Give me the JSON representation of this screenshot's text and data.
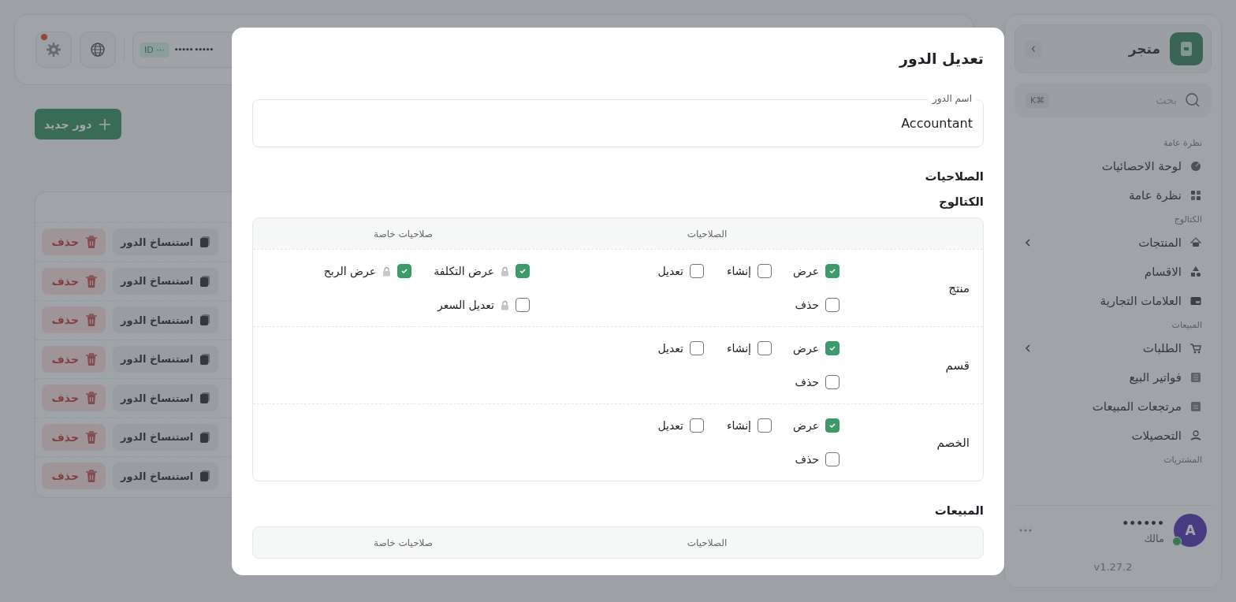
{
  "topbar": {
    "id_badge": "ID ···",
    "account": "••••• •••••",
    "settings_alert": true
  },
  "new_role_button": "دور جديد",
  "role_rows": [
    {
      "copy": "استنساخ الدور",
      "delete": "حذف"
    },
    {
      "copy": "استنساخ الدور",
      "delete": "حذف"
    },
    {
      "copy": "استنساخ الدور",
      "delete": "حذف"
    },
    {
      "copy": "استنساخ الدور",
      "delete": "حذف"
    },
    {
      "copy": "استنساخ الدور",
      "delete": "حذف"
    },
    {
      "copy": "استنساخ الدور",
      "delete": "حذف"
    },
    {
      "copy": "استنساخ الدور",
      "delete": "حذف"
    }
  ],
  "sidebar": {
    "brand": "متجر",
    "search_placeholder": "بحث",
    "shortcut": "K⌘",
    "groups": [
      {
        "label": "نظرة عامة",
        "items": [
          {
            "label": "لوحة الاحصائيات",
            "expandable": false
          },
          {
            "label": "نظرة عامة",
            "expandable": false
          }
        ]
      },
      {
        "label": "الكتالوج",
        "items": [
          {
            "label": "المنتجات",
            "expandable": true
          },
          {
            "label": "الاقسام",
            "expandable": false
          },
          {
            "label": "العلامات التجارية",
            "expandable": false
          }
        ]
      },
      {
        "label": "المبيعات",
        "items": [
          {
            "label": "الطلبات",
            "expandable": true
          },
          {
            "label": "فواتير البيع",
            "expandable": false
          },
          {
            "label": "مرتجعات المبيعات",
            "expandable": false
          },
          {
            "label": "التحصيلات",
            "expandable": false
          }
        ]
      },
      {
        "label": "المشتريات"
      }
    ],
    "user": {
      "avatar": "A",
      "name": "••••••",
      "role": "مالك",
      "online": true
    },
    "version": "v1.27.2"
  },
  "modal": {
    "title": "تعديل الدور",
    "name_field": {
      "label": "اسم الدور",
      "value": "Accountant"
    },
    "permissions_title": "الصلاحيات",
    "sections": [
      {
        "title": "الكتالوج",
        "columns": [
          "الصلاحيات",
          "صلاحيات خاصة"
        ],
        "rows": [
          {
            "name": "منتج",
            "permissions": [
              {
                "label": "عرض",
                "checked": true
              },
              {
                "label": "إنشاء",
                "checked": false
              },
              {
                "label": "تعديل",
                "checked": false
              },
              {
                "label": "حذف",
                "checked": false
              }
            ],
            "special": [
              {
                "label": "عرض التكلفة",
                "checked": true
              },
              {
                "label": "عرض الربح",
                "checked": true
              },
              {
                "label": "تعديل السعر",
                "checked": false
              }
            ]
          },
          {
            "name": "قسم",
            "permissions": [
              {
                "label": "عرض",
                "checked": true
              },
              {
                "label": "إنشاء",
                "checked": false
              },
              {
                "label": "تعديل",
                "checked": false
              },
              {
                "label": "حذف",
                "checked": false
              }
            ],
            "special": []
          },
          {
            "name": "الخصم",
            "permissions": [
              {
                "label": "عرض",
                "checked": true
              },
              {
                "label": "إنشاء",
                "checked": false
              },
              {
                "label": "تعديل",
                "checked": false
              },
              {
                "label": "حذف",
                "checked": false
              }
            ],
            "special": []
          }
        ]
      },
      {
        "title": "المبيعات",
        "columns": [
          "الصلاحيات",
          "صلاحيات خاصة"
        ]
      }
    ]
  }
}
